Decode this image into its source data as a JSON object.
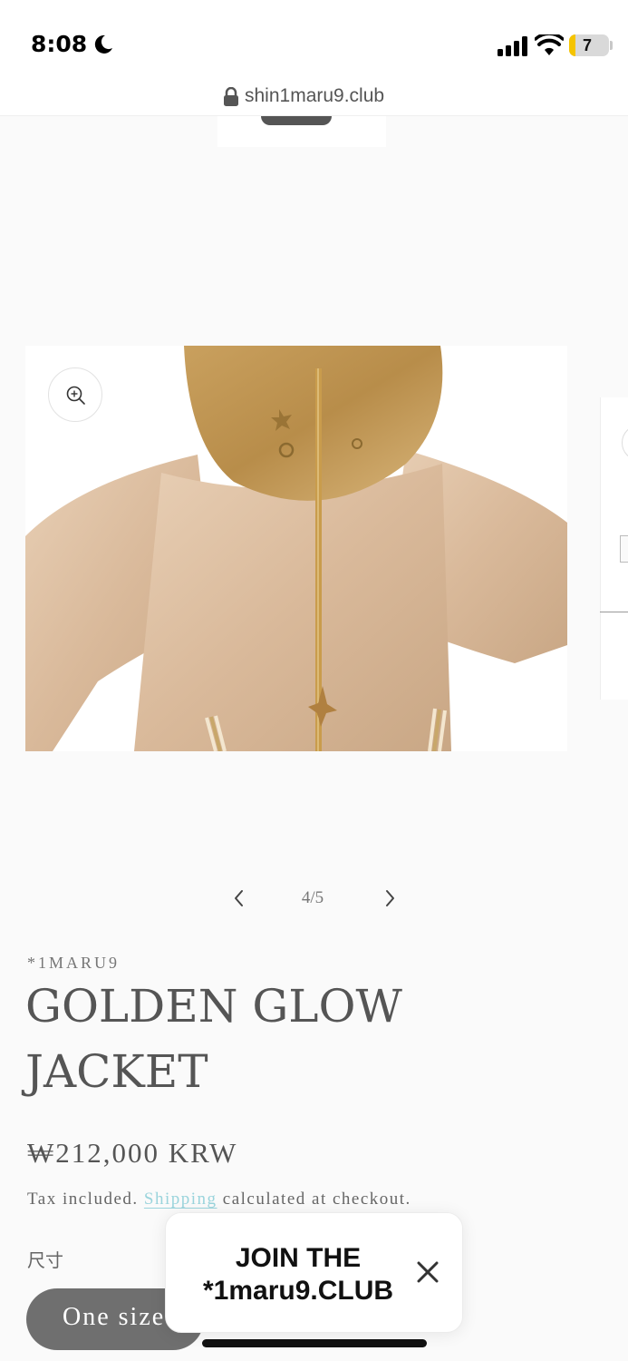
{
  "status_bar": {
    "time": "8:08",
    "battery": "7",
    "battery_level": 0.07,
    "icons": [
      "moon-icon",
      "signal-icon",
      "wifi-icon",
      "battery-icon"
    ]
  },
  "browser": {
    "url": "shin1maru9.club"
  },
  "gallery": {
    "counter": "4/5",
    "current": 4,
    "total": 5
  },
  "product": {
    "vendor": "*1MARU9",
    "title": "GOLDEN GLOW JACKET",
    "price": "₩212,000 KRW",
    "tax_prefix": "Tax included.",
    "shipping_link": "Shipping",
    "tax_suffix": "calculated at checkout.",
    "size_label": "尺寸",
    "size_option": "One size"
  },
  "popup": {
    "line1": "JOIN THE",
    "line2": "*1maru9.CLUB"
  },
  "colors": {
    "accent_link": "#9ad4dc",
    "pill": "#6f6f6f",
    "battery_fill": "#f5c400"
  }
}
